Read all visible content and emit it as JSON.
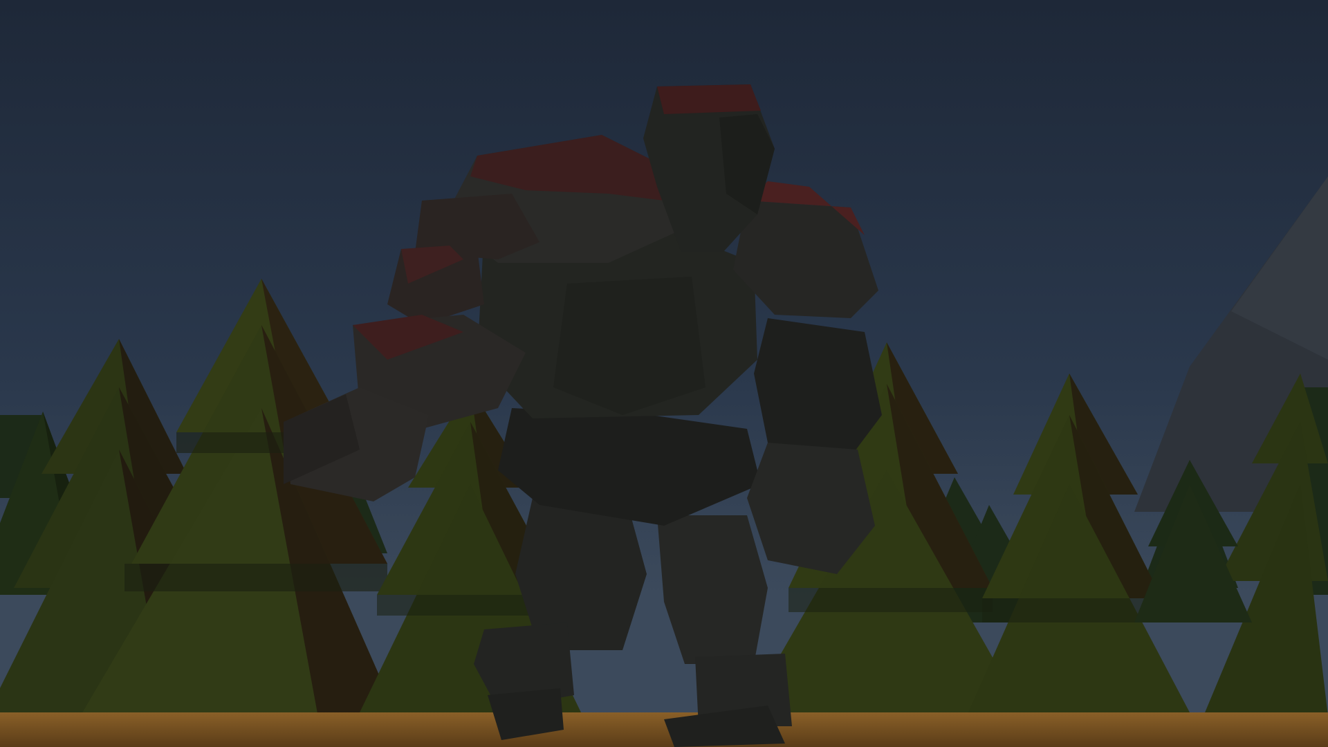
{
  "scene": {
    "sky_top": "#1f2a3c",
    "sky_bottom": "#445365",
    "ground_color": "#6a4a22",
    "tree_color": "#2f3a19",
    "mountain_color": "#30363d",
    "golem_stone_color": "#262826",
    "golem_moss_color": "#4a2020"
  }
}
